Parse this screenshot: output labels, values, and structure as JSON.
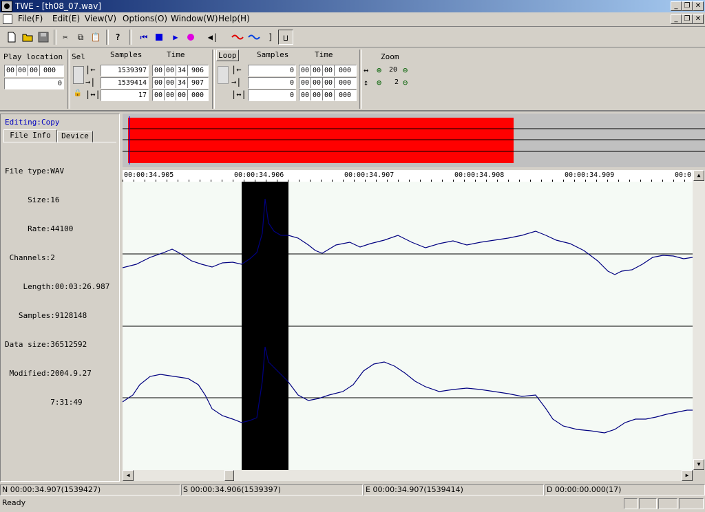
{
  "window": {
    "title": "TWE - [th08_07.wav]"
  },
  "menu": [
    "File(F)",
    "Edit(E)",
    "View(V)",
    "Options(O)",
    "Window(W)",
    "Help(H)"
  ],
  "toolbar": [
    "new-icon",
    "open-icon",
    "save-icon",
    "cut-icon",
    "copy-icon",
    "paste-icon",
    "help-icon",
    "skip-start-icon",
    "stop-icon",
    "play-icon",
    "record-icon",
    "mute-icon",
    "wave-red-icon",
    "wave-blue-icon",
    "bracket-icon",
    "ruler-icon"
  ],
  "play_location": {
    "label": "Play location",
    "time": [
      "00",
      "00",
      "00",
      "000"
    ],
    "samples": "0"
  },
  "sel": {
    "label": "Sel",
    "samples_header": "Samples",
    "time_header": "Time",
    "rows": [
      {
        "samples": "1539397",
        "time": [
          "00",
          "00",
          "34",
          "906"
        ]
      },
      {
        "samples": "1539414",
        "time": [
          "00",
          "00",
          "34",
          "907"
        ]
      },
      {
        "samples": "17",
        "time": [
          "00",
          "00",
          "00",
          "000"
        ]
      }
    ]
  },
  "loop": {
    "label": "Loop",
    "samples_header": "Samples",
    "time_header": "Time",
    "rows": [
      {
        "samples": "0",
        "time": [
          "00",
          "00",
          "00",
          "000"
        ]
      },
      {
        "samples": "0",
        "time": [
          "00",
          "00",
          "00",
          "000"
        ]
      },
      {
        "samples": "0",
        "time": [
          "00",
          "00",
          "00",
          "000"
        ]
      }
    ]
  },
  "zoom": {
    "label": "Zoom",
    "horizontal": "20",
    "vertical": "2"
  },
  "sidebar": {
    "editing": "Editing:Copy",
    "tabs": [
      "File Info",
      "Device"
    ],
    "info": [
      "File type:WAV",
      "     Size:16",
      "     Rate:44100",
      " Channels:2",
      "    Length:00:03:26.987",
      "   Samples:9128148",
      "Data size:36512592",
      " Modified:2004.9.27",
      "          7:31:49"
    ]
  },
  "ruler": [
    "00:00:34.905",
    "00:00:34.906",
    "00:00:34.907",
    "00:00:34.908",
    "00:00:34.909",
    "00:0"
  ],
  "status": {
    "n": "N 00:00:34.907(1539427)",
    "s": "S 00:00:34.906(1539397)",
    "e": "E 00:00:34.907(1539414)",
    "d": "D 00:00:00.000(17)",
    "ready": "Ready"
  },
  "colors": {
    "overview_wave": "#ff0000",
    "wave_line": "#000080",
    "selection": "#000000",
    "wave_bg": "#f5faf5"
  }
}
